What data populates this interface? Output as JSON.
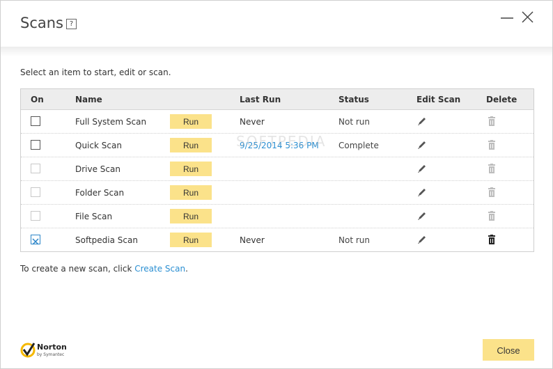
{
  "window": {
    "title": "Scans",
    "help_label": "?"
  },
  "subtitle": "Select an item to start, edit or scan.",
  "table": {
    "headers": {
      "on": "On",
      "name": "Name",
      "last_run": "Last Run",
      "status": "Status",
      "edit": "Edit Scan",
      "delete": "Delete"
    },
    "rows": [
      {
        "checked": false,
        "disabled": false,
        "name": "Full System Scan",
        "run_label": "Run",
        "last_run": "Never",
        "last_run_link": false,
        "status": "Not run",
        "deletable": false
      },
      {
        "checked": false,
        "disabled": false,
        "name": "Quick Scan",
        "run_label": "Run",
        "last_run": "9/25/2014 5:36 PM",
        "last_run_link": true,
        "status": "Complete",
        "deletable": false
      },
      {
        "checked": false,
        "disabled": true,
        "name": "Drive Scan",
        "run_label": "Run",
        "last_run": "",
        "last_run_link": false,
        "status": "",
        "deletable": false
      },
      {
        "checked": false,
        "disabled": true,
        "name": "Folder Scan",
        "run_label": "Run",
        "last_run": "",
        "last_run_link": false,
        "status": "",
        "deletable": false
      },
      {
        "checked": false,
        "disabled": true,
        "name": "File Scan",
        "run_label": "Run",
        "last_run": "",
        "last_run_link": false,
        "status": "",
        "deletable": false
      },
      {
        "checked": true,
        "disabled": false,
        "name": "Softpedia Scan",
        "run_label": "Run",
        "last_run": "Never",
        "last_run_link": false,
        "status": "Not run",
        "deletable": true
      }
    ]
  },
  "footer": {
    "prefix": "To create a new scan, click ",
    "link": "Create Scan",
    "suffix": "."
  },
  "logo": {
    "name": "Norton",
    "sub": "by Symantec"
  },
  "close_label": "Close",
  "watermark": "SOFTPEDIA",
  "colors": {
    "accent_button": "#fbe28a",
    "link": "#2b8fd2",
    "check": "#2b85c8"
  }
}
